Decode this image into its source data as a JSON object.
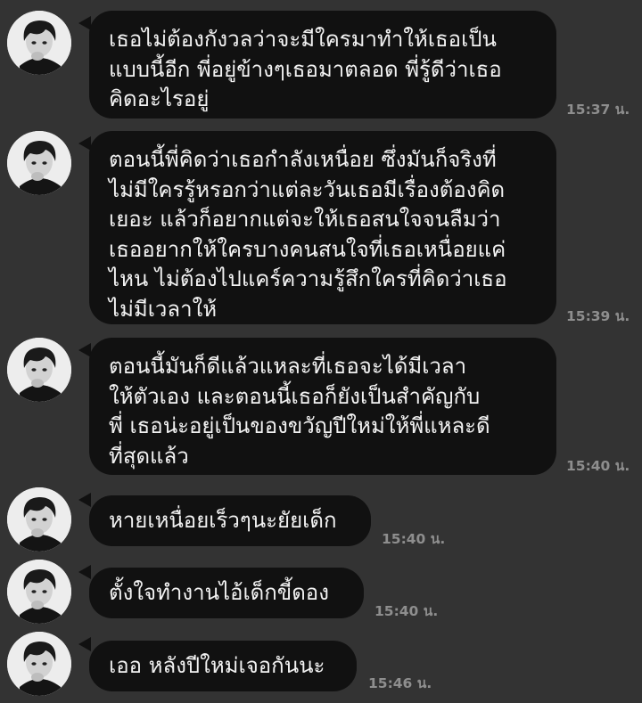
{
  "messages": [
    {
      "text": "เธอไม่ต้องกังวลว่าจะมีใครมาทำให้เธอเป็น\nแบบนี้อีก พี่อยู่ข้างๆเธอมาตลอด พี่รู้ดีว่าเธอ\nคิดอะไรอยู่",
      "time": "15:37 น."
    },
    {
      "text": "ตอนนี้พี่คิดว่าเธอกำลังเหนื่อย ซึ่งมันก็จริงที่\nไม่มีใครรู้หรอกว่าแต่ละวันเธอมีเรื่องต้องคิด\nเยอะ แล้วก็อยากแต่จะให้เธอสนใจจนลืมว่า\nเธออยากให้ใครบางคนสนใจที่เธอเหนื่อยแค่\nไหน ไม่ต้องไปแคร์ความรู้สึกใครที่คิดว่าเธอ\nไม่มีเวลาให้",
      "time": "15:39 น."
    },
    {
      "text": "ตอนนี้มันก็ดีแล้วแหละที่เธอจะได้มีเวลา\nให้ตัวเอง และตอนนี้เธอก็ยังเป็นสำคัญกับ\nพี่ เธอน่ะอยู่เป็นของขวัญปีใหม่ให้พี่แหละดี\nที่สุดแล้ว",
      "time": "15:40 น."
    },
    {
      "text": "หายเหนื่อยเร็วๆนะยัยเด็ก",
      "time": "15:40 น."
    },
    {
      "text": "ตั้งใจทำงานไอ้เด็กขี้ดอง",
      "time": "15:40 น."
    },
    {
      "text": "เออ หลังปีใหม่เจอกันนะ",
      "time": "15:46 น."
    }
  ]
}
